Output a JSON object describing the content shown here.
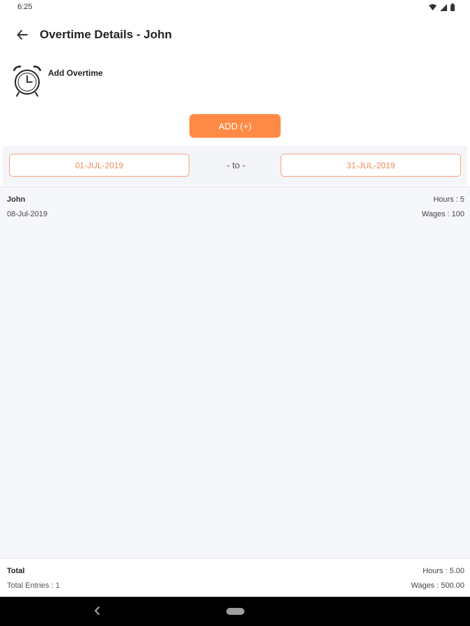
{
  "status_bar": {
    "time": "6:25",
    "icons": [
      "wifi-icon",
      "signal-icon",
      "battery-icon"
    ]
  },
  "header": {
    "title": "Overtime Details - John",
    "back_icon": "arrow-left-icon"
  },
  "add_overtime": {
    "icon": "alarm-clock-icon",
    "label": "Add Overtime",
    "button_label": "ADD (+)"
  },
  "date_range": {
    "from": "01-JUL-2019",
    "separator": "- to -",
    "to": "31-JUL-2019"
  },
  "entries": [
    {
      "name": "John",
      "date": "08-Jul-2019",
      "hours": "Hours : 5",
      "wages": "Wages : 100"
    }
  ],
  "footer": {
    "total_label": "Total",
    "total_entries": "Total Entries : 1",
    "hours": "Hours : 5.00",
    "wages": "Wages : 500.00"
  },
  "colors": {
    "accent": "#ff8a45",
    "date_text": "#f08a5a",
    "list_background": "#f6f7fb",
    "nav_bar": "#000000"
  }
}
